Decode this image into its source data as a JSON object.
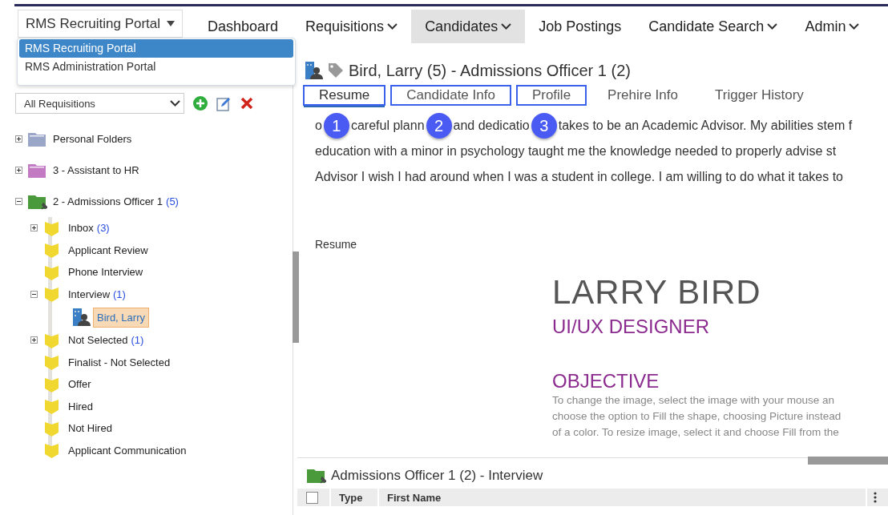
{
  "nav": {
    "portal_button": "RMS Recruiting Portal",
    "items": [
      {
        "label": "Dashboard",
        "has_menu": false,
        "selected": false
      },
      {
        "label": "Requisitions",
        "has_menu": true,
        "selected": false
      },
      {
        "label": "Candidates",
        "has_menu": true,
        "selected": true
      },
      {
        "label": "Job Postings",
        "has_menu": false,
        "selected": false
      },
      {
        "label": "Candidate Search",
        "has_menu": true,
        "selected": false
      },
      {
        "label": "Admin",
        "has_menu": true,
        "selected": false
      }
    ]
  },
  "portal_menu": [
    {
      "label": "RMS Recruiting Portal",
      "selected": true
    },
    {
      "label": "RMS Administration Portal",
      "selected": false
    }
  ],
  "sidebar": {
    "filter": "All Requisitions",
    "tree": [
      {
        "kind": "folder",
        "label": "Personal Folders",
        "color": "#9aa6c8",
        "expanded": false
      },
      {
        "kind": "folder",
        "label": "3 - Assistant to HR",
        "color": "#c27bc2",
        "expanded": false
      },
      {
        "kind": "pinned_folder",
        "label": "2 - Admissions Officer 1",
        "count": "(5)",
        "color": "#4a9a3c",
        "expanded": true,
        "children": [
          {
            "kind": "stage",
            "label": "Inbox",
            "count": "(3)",
            "expanded": false
          },
          {
            "kind": "stage",
            "label": "Applicant Review"
          },
          {
            "kind": "stage",
            "label": "Phone Interview"
          },
          {
            "kind": "stage",
            "label": "Interview",
            "count": "(1)",
            "expanded": true,
            "children": [
              {
                "kind": "candidate",
                "label": "Bird, Larry",
                "selected": true
              }
            ]
          },
          {
            "kind": "stage",
            "label": "Not Selected",
            "count": "(1)",
            "expanded": false
          },
          {
            "kind": "stage",
            "label": "Finalist - Not Selected"
          },
          {
            "kind": "stage",
            "label": "Offer"
          },
          {
            "kind": "stage",
            "label": "Hired"
          },
          {
            "kind": "stage",
            "label": "Not Hired"
          },
          {
            "kind": "stage",
            "label": "Applicant Communication"
          }
        ]
      }
    ]
  },
  "candidate": {
    "title": "Bird, Larry (5) - Admissions Officer 1 (2)",
    "tabs": [
      {
        "label": "Resume",
        "selected": true,
        "highlighted": true
      },
      {
        "label": "Candidate Info",
        "selected": false,
        "highlighted": true
      },
      {
        "label": "Profile",
        "selected": false,
        "highlighted": true
      },
      {
        "label": "Prehire Info",
        "selected": false,
        "highlighted": false
      },
      {
        "label": "Trigger History",
        "selected": false,
        "highlighted": false
      }
    ],
    "letter_first_line": [
      {
        "kind": "text",
        "text": "o"
      },
      {
        "kind": "badge",
        "text": "1"
      },
      {
        "kind": "text",
        "text": "careful plann"
      },
      {
        "kind": "badge",
        "text": "2"
      },
      {
        "kind": "text",
        "text": "and dedicatio"
      },
      {
        "kind": "badge",
        "text": "3"
      },
      {
        "kind": "text",
        "text": "takes to be an Academic Advisor. My abilities stem f"
      }
    ],
    "letter_lines": [
      "education with a minor in psychology taught me the knowledge needed to properly advise st",
      "Advisor I wish I had around when I was a student in college. I am willing to do what it takes to"
    ],
    "section_label": "Resume",
    "resume": {
      "name": "LARRY BIRD",
      "role": "UI/UX DESIGNER",
      "heading": "OBJECTIVE",
      "lines": [
        "To change the image, select the image with your mouse an",
        "choose the option to Fill the shape, choosing Picture instead",
        "of a color.  To resize image, select it and choose Fill from the"
      ]
    }
  },
  "bottom_panel": {
    "title": "Admissions Officer 1 (2) - Interview",
    "select_all": {
      "checked": false
    },
    "columns": [
      "Type",
      "First Name"
    ]
  }
}
